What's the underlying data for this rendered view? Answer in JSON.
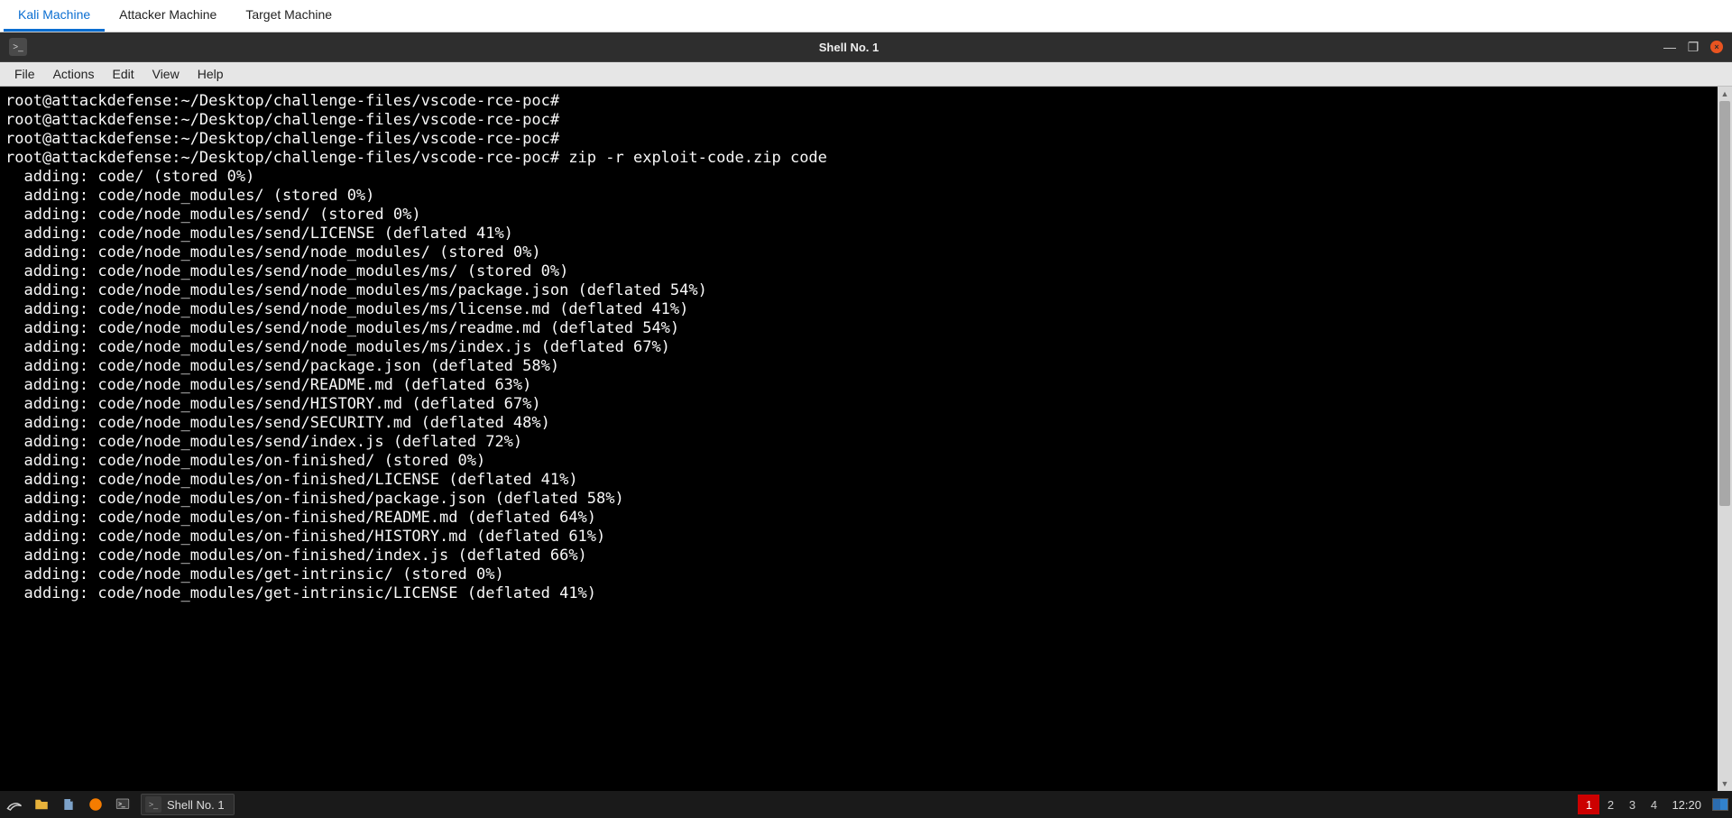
{
  "top_tabs": {
    "items": [
      {
        "label": "Kali Machine",
        "active": true
      },
      {
        "label": "Attacker Machine",
        "active": false
      },
      {
        "label": "Target Machine",
        "active": false
      }
    ]
  },
  "window": {
    "title": "Shell No. 1",
    "menu": [
      "File",
      "Actions",
      "Edit",
      "View",
      "Help"
    ]
  },
  "terminal": {
    "prompt": "root@attackdefense:~/Desktop/challenge-files/vscode-rce-poc#",
    "command": "zip -r exploit-code.zip code",
    "lines": [
      "root@attackdefense:~/Desktop/challenge-files/vscode-rce-poc#",
      "root@attackdefense:~/Desktop/challenge-files/vscode-rce-poc#",
      "root@attackdefense:~/Desktop/challenge-files/vscode-rce-poc#",
      "root@attackdefense:~/Desktop/challenge-files/vscode-rce-poc# zip -r exploit-code.zip code",
      "  adding: code/ (stored 0%)",
      "  adding: code/node_modules/ (stored 0%)",
      "  adding: code/node_modules/send/ (stored 0%)",
      "  adding: code/node_modules/send/LICENSE (deflated 41%)",
      "  adding: code/node_modules/send/node_modules/ (stored 0%)",
      "  adding: code/node_modules/send/node_modules/ms/ (stored 0%)",
      "  adding: code/node_modules/send/node_modules/ms/package.json (deflated 54%)",
      "  adding: code/node_modules/send/node_modules/ms/license.md (deflated 41%)",
      "  adding: code/node_modules/send/node_modules/ms/readme.md (deflated 54%)",
      "  adding: code/node_modules/send/node_modules/ms/index.js (deflated 67%)",
      "  adding: code/node_modules/send/package.json (deflated 58%)",
      "  adding: code/node_modules/send/README.md (deflated 63%)",
      "  adding: code/node_modules/send/HISTORY.md (deflated 67%)",
      "  adding: code/node_modules/send/SECURITY.md (deflated 48%)",
      "  adding: code/node_modules/send/index.js (deflated 72%)",
      "  adding: code/node_modules/on-finished/ (stored 0%)",
      "  adding: code/node_modules/on-finished/LICENSE (deflated 41%)",
      "  adding: code/node_modules/on-finished/package.json (deflated 58%)",
      "  adding: code/node_modules/on-finished/README.md (deflated 64%)",
      "  adding: code/node_modules/on-finished/HISTORY.md (deflated 61%)",
      "  adding: code/node_modules/on-finished/index.js (deflated 66%)",
      "  adding: code/node_modules/get-intrinsic/ (stored 0%)",
      "  adding: code/node_modules/get-intrinsic/LICENSE (deflated 41%)"
    ]
  },
  "taskbar": {
    "app_label": "Shell No. 1",
    "workspaces": [
      "1",
      "2",
      "3",
      "4"
    ],
    "active_workspace": 0,
    "clock": "12:20"
  }
}
